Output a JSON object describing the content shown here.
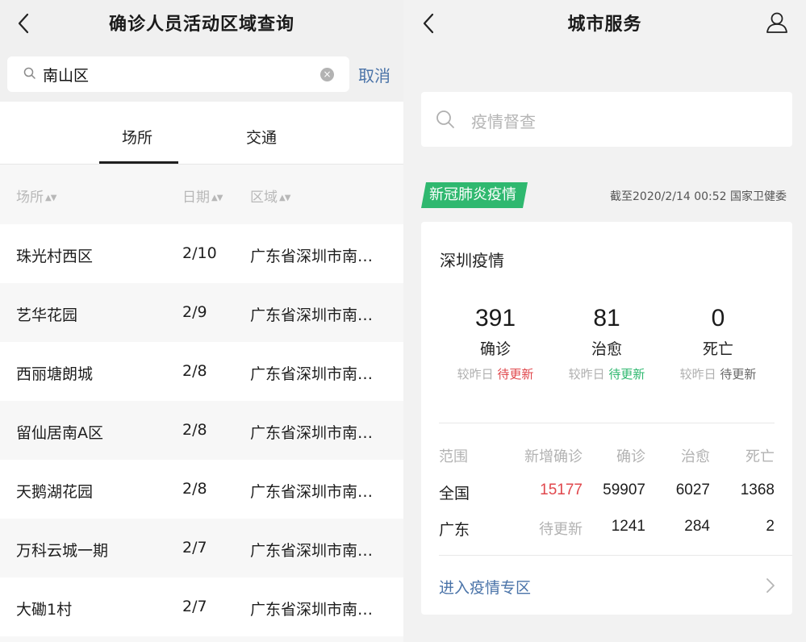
{
  "left": {
    "title": "确诊人员活动区域查询",
    "search": {
      "value": "南山区",
      "placeholder": ""
    },
    "cancel_label": "取消",
    "tabs": [
      {
        "label": "场所",
        "active": true
      },
      {
        "label": "交通",
        "active": false
      }
    ],
    "columns": [
      {
        "label": "场所"
      },
      {
        "label": "日期"
      },
      {
        "label": "区域"
      }
    ],
    "rows": [
      {
        "place": "珠光村西区",
        "date": "2/10",
        "area": "广东省深圳市南…"
      },
      {
        "place": "艺华花园",
        "date": "2/9",
        "area": "广东省深圳市南…"
      },
      {
        "place": "西丽塘朗城",
        "date": "2/8",
        "area": "广东省深圳市南…"
      },
      {
        "place": "留仙居南A区",
        "date": "2/8",
        "area": "广东省深圳市南…"
      },
      {
        "place": "天鹅湖花园",
        "date": "2/8",
        "area": "广东省深圳市南…"
      },
      {
        "place": "万科云城一期",
        "date": "2/7",
        "area": "广东省深圳市南…"
      },
      {
        "place": "大磡1村",
        "date": "2/7",
        "area": "广东省深圳市南…"
      }
    ],
    "icons": {
      "back": "chevron-left-icon",
      "search": "search-icon",
      "clear": "clear-icon",
      "sort": "sort-icon"
    }
  },
  "right": {
    "title": "城市服务",
    "search_placeholder": "疫情督查",
    "badge": "新冠肺炎疫情",
    "source": "截至2020/2/14 00:52 国家卫健委",
    "card": {
      "title": "深圳疫情",
      "stats": [
        {
          "value": "391",
          "label": "确诊",
          "compare_prefix": "较昨日",
          "compare_value": "待更新",
          "color": "#e0474c"
        },
        {
          "value": "81",
          "label": "治愈",
          "compare_prefix": "较昨日",
          "compare_value": "待更新",
          "color": "#2fb86f"
        },
        {
          "value": "0",
          "label": "死亡",
          "compare_prefix": "较昨日",
          "compare_value": "待更新",
          "color": "#666666"
        }
      ],
      "table": {
        "headers": [
          "范围",
          "新增确诊",
          "确诊",
          "治愈",
          "死亡"
        ],
        "rows": [
          {
            "scope": "全国",
            "new": "15177",
            "confirmed": "59907",
            "cured": "6027",
            "dead": "1368"
          },
          {
            "scope": "广东",
            "new": "待更新",
            "confirmed": "1241",
            "cured": "284",
            "dead": "2"
          }
        ]
      },
      "link": "进入疫情专区"
    },
    "icons": {
      "back": "chevron-left-icon",
      "user": "user-icon",
      "search": "search-icon",
      "chevron": "chevron-right-icon"
    },
    "colors": {
      "accent": "#2fb86f",
      "danger": "#e0474c",
      "link": "#4a73a8"
    }
  }
}
